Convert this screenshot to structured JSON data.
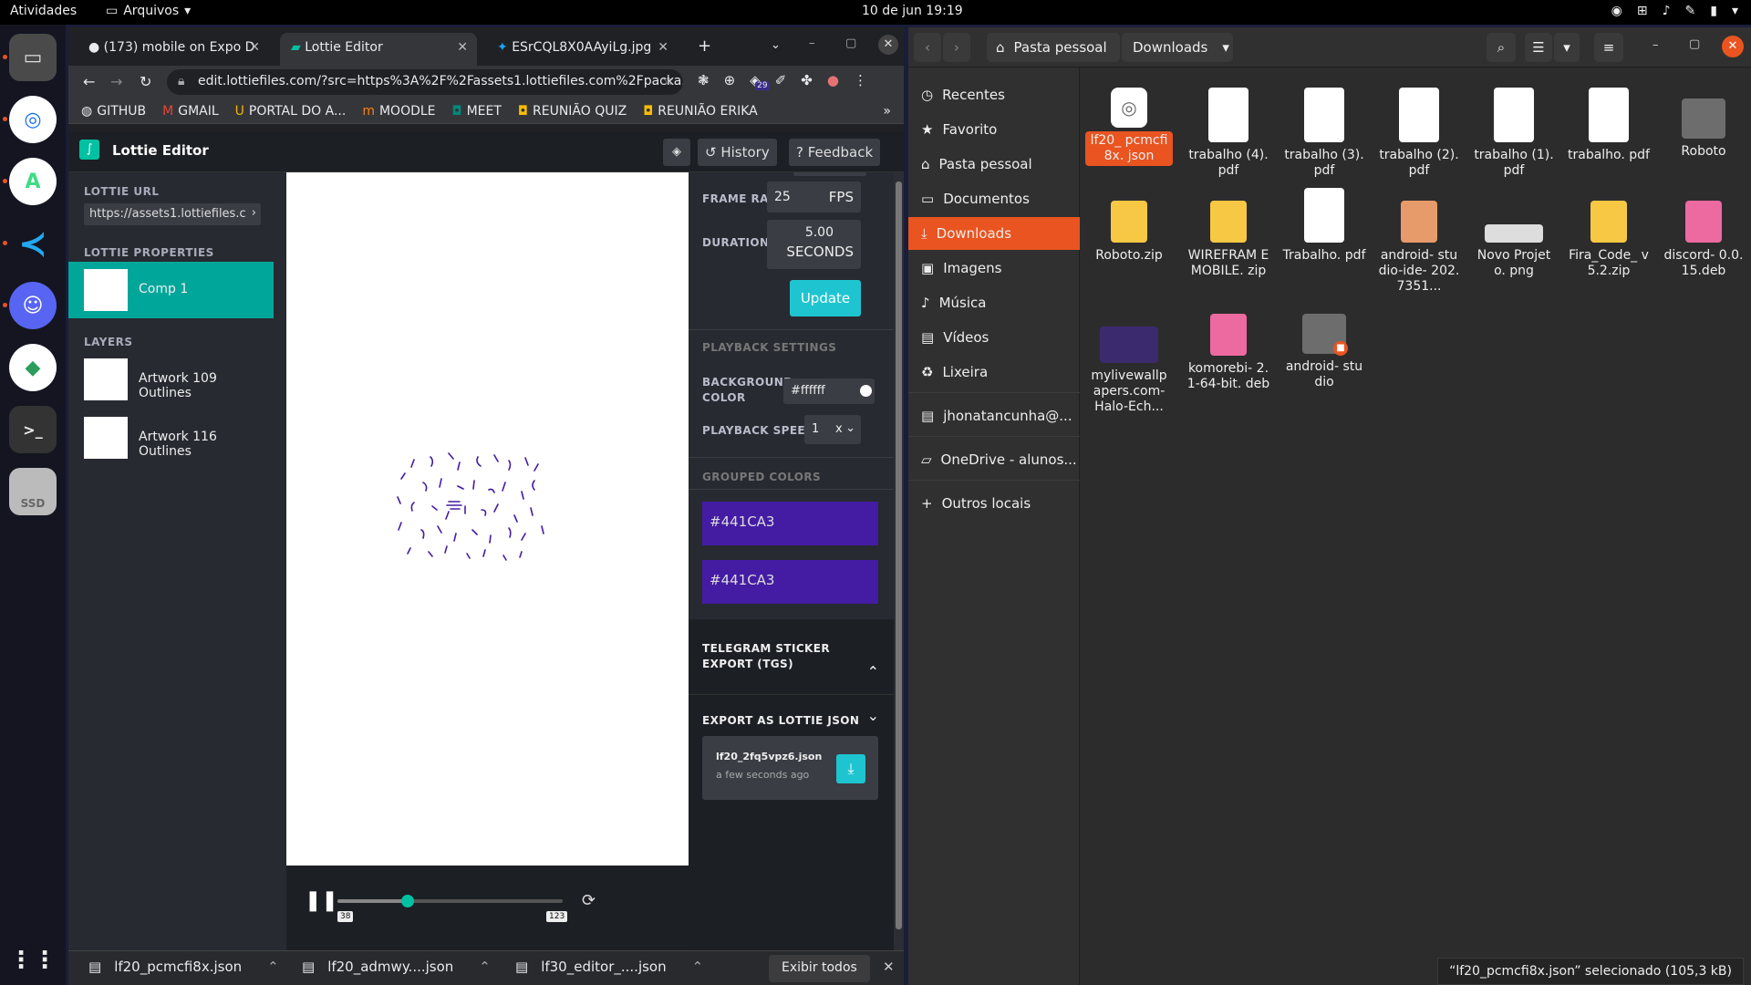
{
  "topbar": {
    "activities": "Atividades",
    "files_menu": "Arquivos",
    "clock": "10 de jun  19:19"
  },
  "dock": {
    "items": [
      "Files",
      "Chrome",
      "Android Studio",
      "VS Code",
      "Discord",
      "Android app",
      "Terminal",
      "SSD"
    ],
    "ssd_label": "SSD"
  },
  "chrome": {
    "tabs": [
      {
        "label": "(173) mobile on Expo D",
        "active": false
      },
      {
        "label": "Lottie Editor",
        "active": true
      },
      {
        "label": "ESrCQL8X0AAyiLg.jpg",
        "active": false
      }
    ],
    "url": "edit.lottiefiles.com/?src=https%3A%2F%2Fassets1.lottiefiles.com%2Fpacka...",
    "extension_badge": "29",
    "bookmarks": [
      "GITHUB",
      "GMAIL",
      "PORTAL DO A...",
      "MOODLE",
      "MEET",
      "REUNIÃO QUIZ",
      "REUNIÃO ERIKA"
    ],
    "bookmarks_more": "»"
  },
  "lottie": {
    "title": "Lottie Editor",
    "history_label": "History",
    "feedback_label": "Feedback",
    "url_label": "LOTTIE URL",
    "url_value": "https://assets1.lottiefiles.c",
    "props_label": "LOTTIE PROPERTIES",
    "comp_name": "Comp 1",
    "layers_label": "LAYERS",
    "layers": [
      "Artwork 109 Outlines",
      "Artwork 116 Outlines"
    ],
    "frame_rate_label": "FRAME RATE",
    "frame_rate_value": "25",
    "frame_rate_unit": "FPS",
    "duration_label": "DURATION",
    "duration_value": "5.00",
    "duration_unit": "SECONDS",
    "update_label": "Update",
    "playback_settings_label": "PLAYBACK SETTINGS",
    "bg_color_label": "BACKGROUND COLOR",
    "bg_color_value": "#ffffff",
    "playback_speed_label": "PLAYBACK SPEED",
    "playback_speed_value": "1",
    "playback_speed_unit": "x",
    "grouped_colors_label": "GROUPED COLORS",
    "grouped_colors": [
      "#441CA3",
      "#441CA3"
    ],
    "telegram_label": "TELEGRAM STICKER EXPORT (TGS)",
    "export_label": "EXPORT AS LOTTIE JSON",
    "export_file": "lf20_2fq5vpz6.json",
    "export_time": "a few seconds ago",
    "frame_start": "38",
    "frame_end": "123",
    "progress_fraction": 0.31
  },
  "downloads": {
    "items": [
      "lf20_pcmcfi8x.json",
      "lf20_admwy....json",
      "lf30_editor_....json"
    ],
    "show_all": "Exibir todos"
  },
  "files": {
    "home_label": "Pasta pessoal",
    "current_folder": "Downloads",
    "places": [
      {
        "label": "Recentes",
        "icon": "clock-icon"
      },
      {
        "label": "Favorito",
        "icon": "star-icon"
      },
      {
        "label": "Pasta pessoal",
        "icon": "home-icon"
      },
      {
        "label": "Documentos",
        "icon": "document-icon"
      },
      {
        "label": "Downloads",
        "icon": "download-icon"
      },
      {
        "label": "Imagens",
        "icon": "image-icon"
      },
      {
        "label": "Música",
        "icon": "music-icon"
      },
      {
        "label": "Vídeos",
        "icon": "video-icon"
      },
      {
        "label": "Lixeira",
        "icon": "trash-icon"
      },
      {
        "label": "jhonatancunha@...",
        "icon": "network-drive-icon"
      },
      {
        "label": "OneDrive - alunos...",
        "icon": "folder-icon"
      },
      {
        "label": "Outros locais",
        "icon": "plus-icon"
      }
    ],
    "items": [
      {
        "name": "lf20_ pcmcfi8x. json",
        "icon": "json-icon",
        "color": "#ffffff",
        "selected": true
      },
      {
        "name": "trabalho (4).pdf",
        "icon": "pdf-icon",
        "color": "#ffffff"
      },
      {
        "name": "trabalho (3).pdf",
        "icon": "pdf-icon",
        "color": "#ffffff"
      },
      {
        "name": "trabalho (2).pdf",
        "icon": "pdf-icon",
        "color": "#ffffff"
      },
      {
        "name": "trabalho (1).pdf",
        "icon": "pdf-icon",
        "color": "#ffffff"
      },
      {
        "name": "trabalho. pdf",
        "icon": "pdf-icon",
        "color": "#ffffff"
      },
      {
        "name": "Roboto",
        "icon": "folder-icon",
        "color": "#6d6d6d"
      },
      {
        "name": "Roboto.zip",
        "icon": "zip-icon",
        "color": "#f6c844"
      },
      {
        "name": "WIREFRAM E MOBILE. zip",
        "icon": "zip-icon",
        "color": "#f6c844"
      },
      {
        "name": "Trabalho. pdf",
        "icon": "pdf-icon",
        "color": "#ffffff"
      },
      {
        "name": "android- studio-ide- 202.7351...",
        "icon": "archive-icon",
        "color": "#e89b6a"
      },
      {
        "name": "Novo Projeto. png",
        "icon": "image-icon",
        "color": "#dddddd"
      },
      {
        "name": "Fira_Code_ v5.2.zip",
        "icon": "zip-icon",
        "color": "#f6c844"
      },
      {
        "name": "discord- 0.0.15.deb",
        "icon": "deb-icon",
        "color": "#ec6aa0"
      },
      {
        "name": "mylivewallp apers.com- Halo-Ech...",
        "icon": "video-icon",
        "color": "#3b2b6e"
      },
      {
        "name": "komorebi- 2.1-64-bit. deb",
        "icon": "deb-icon",
        "color": "#ec6aa0"
      },
      {
        "name": "android- studio",
        "icon": "locked-folder-icon",
        "color": "#6d6d6d"
      }
    ],
    "status": "“lf20_pcmcfi8x.json” selecionado  (105,3 kB)"
  }
}
